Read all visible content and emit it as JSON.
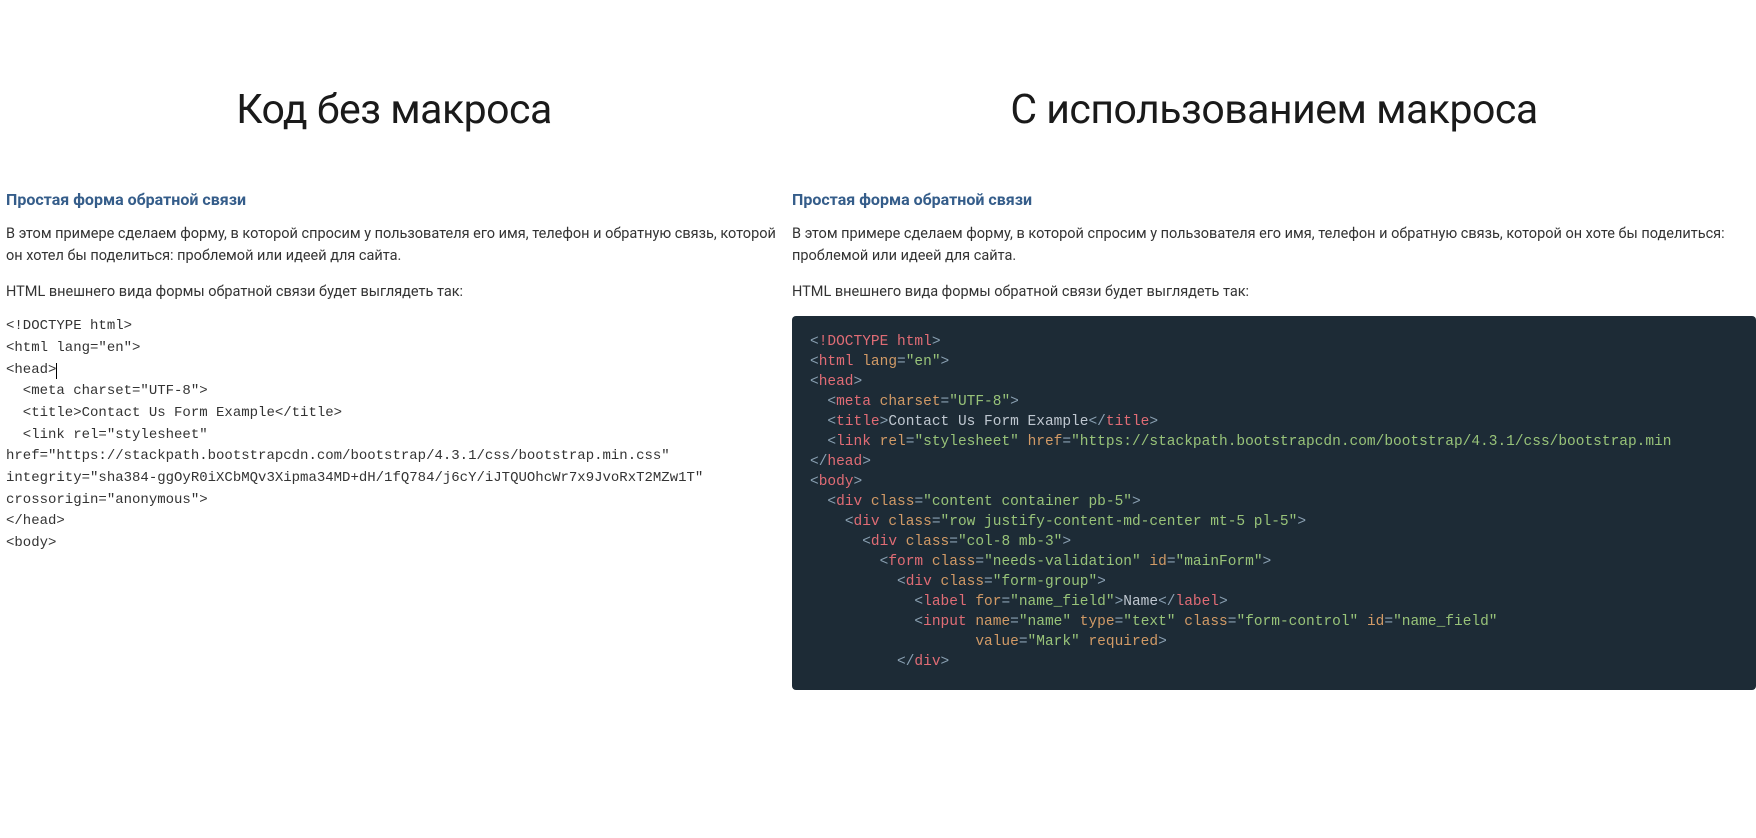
{
  "left": {
    "heading": "Код без макроса",
    "section_title": "Простая форма обратной связи",
    "paragraph1": "В этом примере сделаем форму, в которой спросим у пользователя его имя, телефон и обратную связь, которой он хотел бы поделиться: проблемой или идеей для сайта.",
    "paragraph2": "HTML внешнего вида формы обратной связи будет выглядеть так:",
    "code": {
      "l1": "<!DOCTYPE html>",
      "l2": "<html lang=\"en\">",
      "l3": "<head>",
      "l4": "  <meta charset=\"UTF-8\">",
      "l5": "  <title>Contact Us Form Example</title>",
      "l6": "  <link rel=\"stylesheet\"",
      "l7": "href=\"https://stackpath.bootstrapcdn.com/bootstrap/4.3.1/css/bootstrap.min.css\"",
      "l8": "integrity=\"sha384-ggOyR0iXCbMQv3Xipma34MD+dH/1fQ784/j6cY/iJTQUOhcWr7x9JvoRxT2MZw1T\"",
      "l9": "crossorigin=\"anonymous\">",
      "l10": "</head>",
      "l11": "<body>"
    }
  },
  "right": {
    "heading": "С использованием макроса",
    "section_title": "Простая форма обратной связи",
    "paragraph1": "В этом примере сделаем форму, в которой спросим у пользователя его имя, телефон и обратную связь, которой он хоте бы поделиться: проблемой или идеей для сайта.",
    "paragraph2": "HTML внешнего вида формы обратной связи будет выглядеть так:",
    "code": {
      "doctype": "!DOCTYPE html",
      "html_tag": "html",
      "lang_attr": "lang",
      "lang_val": "\"en\"",
      "head_tag": "head",
      "meta_tag": "meta",
      "charset_attr": "charset",
      "charset_val": "\"UTF-8\"",
      "title_tag": "title",
      "title_text": "Contact Us Form Example",
      "link_tag": "link",
      "rel_attr": "rel",
      "rel_val": "\"stylesheet\"",
      "href_attr": "href",
      "href_val": "\"https://stackpath.bootstrapcdn.com/bootstrap/4.3.1/css/bootstrap.min",
      "body_tag": "body",
      "div_tag": "div",
      "class_attr": "class",
      "div1_class": "\"content container pb-5\"",
      "div2_class": "\"row justify-content-md-center mt-5 pl-5\"",
      "div3_class": "\"col-8 mb-3\"",
      "form_tag": "form",
      "form_class": "\"needs-validation\"",
      "id_attr": "id",
      "form_id": "\"mainForm\"",
      "div4_class": "\"form-group\"",
      "label_tag": "label",
      "for_attr": "for",
      "label_for": "\"name_field\"",
      "label_text": "Name",
      "input_tag": "input",
      "name_attr": "name",
      "input_name": "\"name\"",
      "type_attr": "type",
      "input_type": "\"text\"",
      "input_class": "\"form-control\"",
      "input_id": "\"name_field\"",
      "value_attr": "value",
      "input_value": "\"Mark\"",
      "required_attr": "required"
    }
  }
}
